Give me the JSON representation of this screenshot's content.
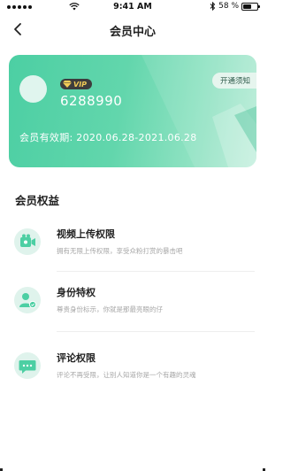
{
  "status_bar": {
    "time": "9:41 AM",
    "battery_text": "58 %",
    "battery_level": 0.58,
    "icons": [
      "signal-dots-icon",
      "wifi-icon",
      "bluetooth-icon",
      "battery-icon"
    ]
  },
  "nav": {
    "title": "会员中心",
    "back_icon": "chevron-left-icon"
  },
  "member_card": {
    "badge": "VIP",
    "user_id": "6288990",
    "validity": "会员有效期: 2020.06.28-2021.06.28",
    "notice_button": "开通须知",
    "colors": {
      "gradient_start": "#4ccfa3",
      "gradient_end": "#b9ecd8",
      "badge_bg": "#3d3d3d",
      "badge_text": "#f3cc57"
    }
  },
  "benefits": {
    "title": "会员权益",
    "items": [
      {
        "icon": "video-camera-icon",
        "title": "视频上传权限",
        "desc": "拥有无限上传权限，享受众粉打赏的暴击吧"
      },
      {
        "icon": "user-badge-icon",
        "title": "身份特权",
        "desc": "尊贵身份标示，你就是那最亮眼的仔"
      },
      {
        "icon": "comment-icon",
        "title": "评论权限",
        "desc": "评论不再受限，让别人知道你是一个有趣的灵魂"
      }
    ],
    "icon_color": "#4ccfa3"
  }
}
